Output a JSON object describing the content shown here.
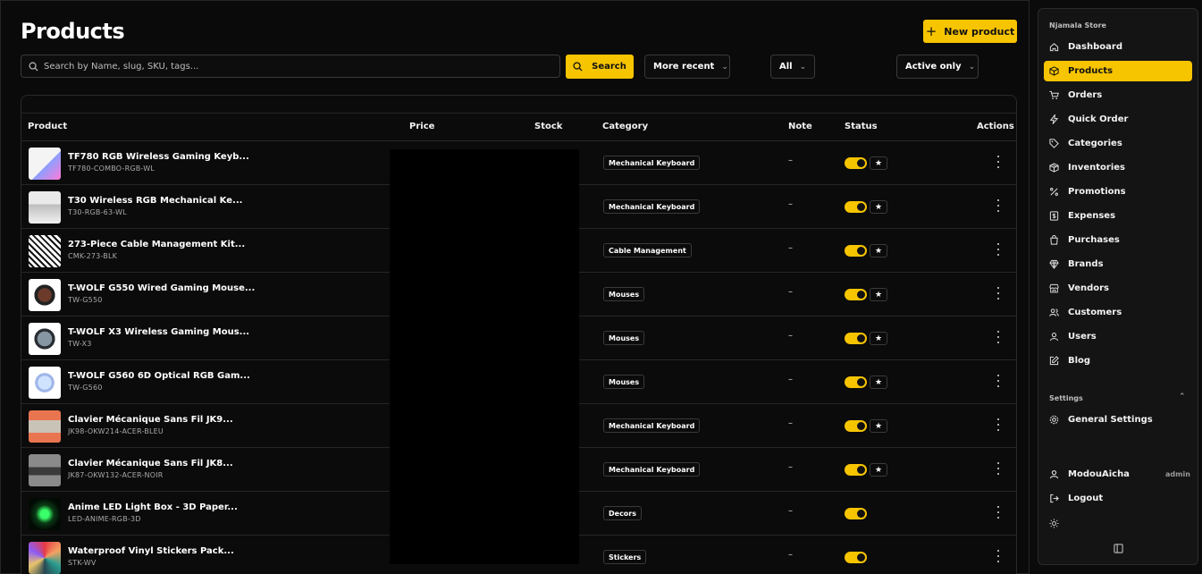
{
  "page": {
    "title": "Products",
    "new_product_label": "New product"
  },
  "toolbar": {
    "search_placeholder": "Search by Name, slug, SKU, tags...",
    "search_label": "Search",
    "sort_value": "More recent",
    "category_value": "All",
    "status_value": "Active only"
  },
  "table": {
    "headers": {
      "product": "Product",
      "price": "Price",
      "stock": "Stock",
      "category": "Category",
      "note": "Note",
      "status": "Status",
      "actions": "Actions"
    },
    "rows": [
      {
        "name": "TF780 RGB Wireless Gaming Keyb...",
        "sku": "TF780-COMBO-RGB-WL",
        "category": "Mechanical Keyboard",
        "note": "–",
        "featured": "★"
      },
      {
        "name": "T30 Wireless RGB Mechanical Ke...",
        "sku": "T30-RGB-63-WL",
        "category": "Mechanical Keyboard",
        "note": "–",
        "featured": "★"
      },
      {
        "name": "273-Piece Cable Management Kit...",
        "sku": "CMK-273-BLK",
        "category": "Cable Management",
        "note": "–",
        "featured": "★"
      },
      {
        "name": "T-WOLF G550 Wired Gaming Mouse...",
        "sku": "TW-G550",
        "category": "Mouses",
        "note": "–",
        "featured": "★"
      },
      {
        "name": "T-WOLF X3 Wireless Gaming Mous...",
        "sku": "TW-X3",
        "category": "Mouses",
        "note": "–",
        "featured": "★"
      },
      {
        "name": "T-WOLF G560 6D Optical RGB Gam...",
        "sku": "TW-G560",
        "category": "Mouses",
        "note": "–",
        "featured": "★"
      },
      {
        "name": "Clavier Mécanique Sans Fil JK9...",
        "sku": "JK98-OKW214-ACER-BLEU",
        "category": "Mechanical Keyboard",
        "note": "–",
        "featured": "★"
      },
      {
        "name": "Clavier Mécanique Sans Fil JK8...",
        "sku": "JK87-OKW132-ACER-NOIR",
        "category": "Mechanical Keyboard",
        "note": "–",
        "featured": "★"
      },
      {
        "name": "Anime LED Light Box - 3D Paper...",
        "sku": "LED-ANIME-RGB-3D",
        "category": "Decors",
        "note": "–",
        "featured": ""
      },
      {
        "name": "Waterproof Vinyl Stickers Pack...",
        "sku": "STK-WV",
        "category": "Stickers",
        "note": "–",
        "featured": ""
      }
    ]
  },
  "sidebar": {
    "store_name": "Njamala Store",
    "items": [
      {
        "label": "Dashboard",
        "icon": "home-icon"
      },
      {
        "label": "Products",
        "icon": "box-icon",
        "active": true
      },
      {
        "label": "Orders",
        "icon": "cart-icon"
      },
      {
        "label": "Quick Order",
        "icon": "bolt-icon"
      },
      {
        "label": "Categories",
        "icon": "tag-icon"
      },
      {
        "label": "Inventories",
        "icon": "package-icon"
      },
      {
        "label": "Promotions",
        "icon": "percent-icon"
      },
      {
        "label": "Expenses",
        "icon": "receipt-icon"
      },
      {
        "label": "Purchases",
        "icon": "bag-icon"
      },
      {
        "label": "Brands",
        "icon": "gem-icon"
      },
      {
        "label": "Vendors",
        "icon": "store-icon"
      },
      {
        "label": "Customers",
        "icon": "users-icon"
      },
      {
        "label": "Users",
        "icon": "user-icon"
      },
      {
        "label": "Blog",
        "icon": "edit-icon"
      }
    ],
    "settings_label": "Settings",
    "general_settings_label": "General Settings",
    "user_name": "ModouAicha",
    "user_role": "admin",
    "logout_label": "Logout"
  },
  "colors": {
    "accent": "#f7c400",
    "background": "#0a0a0a",
    "sidebar": "#141414",
    "border": "#2a2a2a"
  }
}
